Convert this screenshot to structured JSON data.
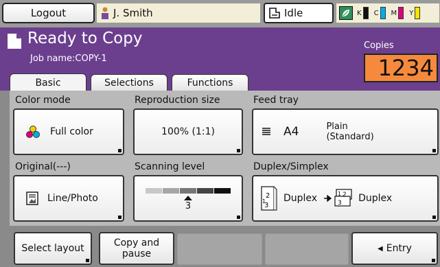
{
  "topbar": {
    "logout_label": "Logout",
    "user_name": "J. Smith",
    "status": "Idle",
    "inks": [
      {
        "label": "K",
        "color": "#111111"
      },
      {
        "label": "C",
        "color": "#00aee8"
      },
      {
        "label": "M",
        "color": "#e2007a"
      },
      {
        "label": "Y",
        "color": "#f5e600"
      }
    ]
  },
  "header": {
    "title": "Ready to Copy",
    "job_name": "Job name:COPY-1",
    "copies_label": "Copies",
    "copies_value": "1234"
  },
  "tabs": [
    {
      "label": "Basic",
      "active": true
    },
    {
      "label": "Selections",
      "active": false
    },
    {
      "label": "Functions",
      "active": false
    }
  ],
  "settings": {
    "color_mode": {
      "label": "Color mode",
      "value": "Full color"
    },
    "reproduction_size": {
      "label": "Reproduction size",
      "value": "100% (1:1)"
    },
    "feed_tray": {
      "label": "Feed tray",
      "size": "A4",
      "paper_line1": "Plain",
      "paper_line2": "(Standard)"
    },
    "original": {
      "label": "Original(---)",
      "value": "Line/Photo"
    },
    "scanning_level": {
      "label": "Scanning level",
      "value": "3"
    },
    "duplex_simplex": {
      "label": "Duplex/Simplex",
      "from": "Duplex",
      "to": "Duplex"
    }
  },
  "bottombar": {
    "select_layout": "Select layout",
    "copy_pause_line1": "Copy and",
    "copy_pause_line2": "pause",
    "entry": "Entry"
  },
  "colors": {
    "header_purple": "#6b3f8e",
    "copies_orange": "#f58a3e",
    "accent_green": "#2e8f5a"
  }
}
